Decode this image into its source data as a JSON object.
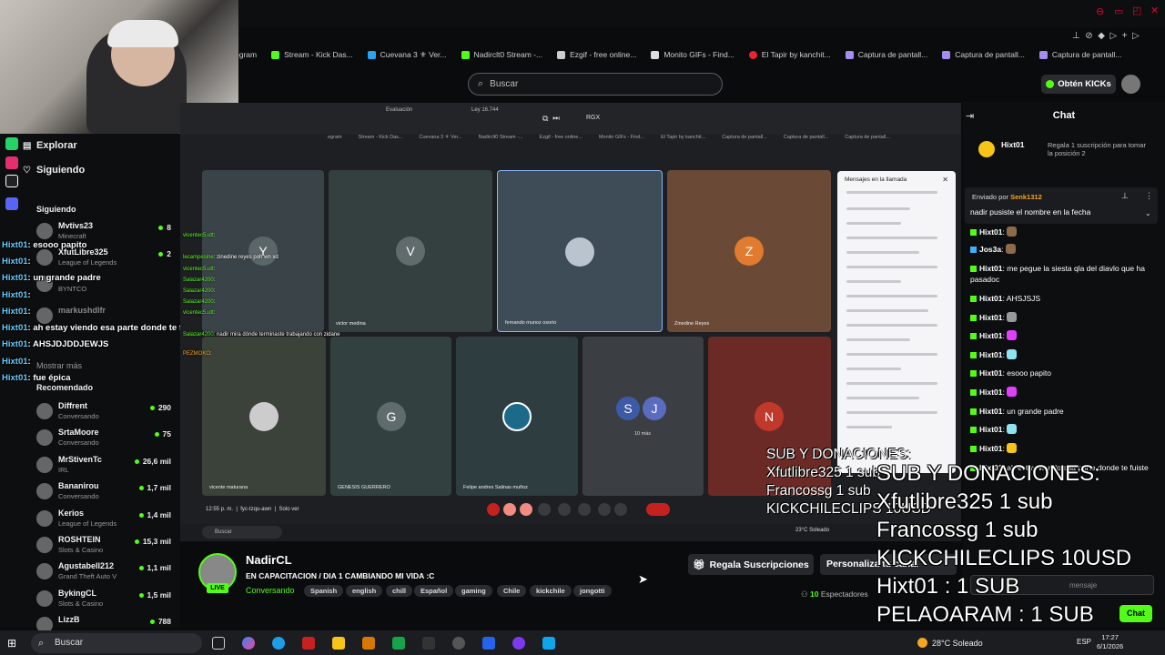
{
  "browser": {
    "bookmarks": [
      "egram",
      "Stream - Kick Das...",
      "Cuevana 3 ⚜ Ver...",
      "Nadirclt0 Stream -...",
      "Ezgif - free online...",
      "Monito GIFs - Find...",
      "El Tapir by kanchit...",
      "Captura de pantall...",
      "Captura de pantall...",
      "Captura de pantall..."
    ],
    "search_placeholder": "Buscar",
    "kicks_button": "Obtén KICKs"
  },
  "sidebar": {
    "explore": "Explorar",
    "following": "Siguiendo",
    "following_title": "Siguiendo",
    "show_more": "Mostrar más",
    "recommended_title": "Recomendado",
    "following_channels": [
      {
        "name": "Mvtivs23",
        "category": "Minecraft",
        "viewers": "8"
      },
      {
        "name": "XfutLibre325",
        "category": "League of Legends",
        "viewers": "2"
      },
      {
        "name": "",
        "category": "BYNTCO",
        "viewers": ""
      },
      {
        "name": "markushdlfr",
        "category": "",
        "viewers": ""
      }
    ],
    "recommended_channels": [
      {
        "name": "Diffrent",
        "category": "Conversando",
        "viewers": "290"
      },
      {
        "name": "SrtaMoore",
        "category": "Conversando",
        "viewers": "75"
      },
      {
        "name": "MrStivenTc",
        "category": "IRL",
        "viewers": "26,6 mil"
      },
      {
        "name": "Bananirou",
        "category": "Conversando",
        "viewers": "1,7 mil"
      },
      {
        "name": "Kerios",
        "category": "League of Legends",
        "viewers": "1,4 mil"
      },
      {
        "name": "ROSHTEIN",
        "category": "Slots & Casino",
        "viewers": "15,3 mil"
      },
      {
        "name": "Agustabell212",
        "category": "Grand Theft Auto V",
        "viewers": "1,1 mil"
      },
      {
        "name": "BykingCL",
        "category": "Slots & Casino",
        "viewers": "1,5 mil"
      },
      {
        "name": "LizzB",
        "category": "ARC Raiders",
        "viewers": "788"
      }
    ]
  },
  "stream_chat_overlay": [
    {
      "user": "Hixt01",
      "text": "esooo papito"
    },
    {
      "user": "Hixt01",
      "text": ""
    },
    {
      "user": "Hixt01",
      "text": "un grande padre"
    },
    {
      "user": "Hixt01",
      "text": ""
    },
    {
      "user": "Hixt01",
      "text": ""
    },
    {
      "user": "Hixt01",
      "text": "ah estay viendo esa parte donde te fuiste"
    },
    {
      "user": "Hixt01",
      "text": "AHSJDJDDJEWJS"
    },
    {
      "user": "Hixt01",
      "text": ""
    },
    {
      "user": "Hixt01",
      "text": "fue épica"
    }
  ],
  "meeting": {
    "tab_label": "Evaluación",
    "tab_label2": "Ley 16.744",
    "bookmarks": [
      "egram",
      "Stream - Kick Das...",
      "Cuevana 3 ⚜ Ver...",
      "Nadirclt0 Stream -...",
      "Ezgif - free online...",
      "Monito GIFs - Find...",
      "El Tapir by kanchit...",
      "Captura de pantall...",
      "Captura de pantall...",
      "Captura de pantall..."
    ],
    "participants": [
      {
        "initial": "Y",
        "name": ""
      },
      {
        "initial": "V",
        "name": "victor medina"
      },
      {
        "initial": "",
        "name": "fernando munoz osorio"
      },
      {
        "initial": "Z",
        "name": "Zinedine Reyes"
      },
      {
        "initial": "",
        "name": "vicente maturana"
      },
      {
        "initial": "G",
        "name": "GENESIS GUERRERO"
      },
      {
        "initial": "",
        "name": "Felipe andres Salinas muñoz"
      },
      {
        "initial": "S",
        "name": "10 más"
      },
      {
        "initial": "N",
        "name": ""
      }
    ],
    "messages_title": "Mensajes en la llamada",
    "time": "12:55 p. m.",
    "code": "fyc-tzqu-awn",
    "mode": "Solo ver",
    "inner_search": "Buscar",
    "inner_weather": "23°C Soleado",
    "overlay_chat": [
      {
        "user": "vicentec5.utt",
        "text": ""
      },
      {
        "user": "lecampesine",
        "text": "zinedine reyes poh wn xd"
      },
      {
        "user": "vicentec5.utt",
        "text": ""
      },
      {
        "user": "Salazar4200",
        "text": ""
      },
      {
        "user": "Salazar4200",
        "text": ""
      },
      {
        "user": "Salazar4200",
        "text": ""
      },
      {
        "user": "vicentec5.utt",
        "text": ""
      },
      {
        "user": "Salazar4200",
        "text": "nadir mira dónde terminaste trabajando con zidane"
      },
      {
        "user": "PEZMOKO",
        "text": ""
      }
    ]
  },
  "stream": {
    "streamer": "NadirCL",
    "live": "LIVE",
    "title": "EN CAPACITACION / DIA 1 CAMBIANDO MI VIDA :C",
    "category": "Conversando",
    "tags": [
      "Spanish",
      "english",
      "chill",
      "Español",
      "gaming",
      "Chile",
      "kickchile",
      "jongotti"
    ],
    "gift_subs": "Regala Suscripciones",
    "customize": "Personaliza tu canal",
    "viewers": "10",
    "viewers_label": "Espectadores"
  },
  "chat": {
    "title": "Chat",
    "gift_user": "Hixt01",
    "gift_text": "Regala 1 suscripción para tomar la posición 2",
    "pinned_by_label": "Enviado por",
    "pinned_by": "Senk1312",
    "pinned_text": "nadir pusiste el nombre en la fecha",
    "messages": [
      {
        "user": "Hixt01",
        "text": ""
      },
      {
        "user": "Jos3a",
        "text": ""
      },
      {
        "user": "Hixt01",
        "text": "me pegue la siesta qla del diavlo que ha pasadoc"
      },
      {
        "user": "Hixt01",
        "text": "AHSJSJS"
      },
      {
        "user": "Hixt01",
        "text": ""
      },
      {
        "user": "Hixt01",
        "text": ""
      },
      {
        "user": "Hixt01",
        "text": ""
      },
      {
        "user": "Hixt01",
        "text": "esooo papito"
      },
      {
        "user": "Hixt01",
        "text": ""
      },
      {
        "user": "Hixt01",
        "text": "un grande padre"
      },
      {
        "user": "Hixt01",
        "text": ""
      },
      {
        "user": "Hixt01",
        "text": ""
      },
      {
        "user": "Hixt01",
        "text": "ah estay viendo esa parte donde te fuiste"
      }
    ],
    "input_placeholder": "mensaje",
    "send": "Chat"
  },
  "overlays": {
    "donations_small": [
      "SUB Y DONACIONES:",
      "Xfutlibre325 1 sub",
      "Francossg 1 sub",
      "KICKCHILECLIPS 10USD"
    ],
    "donations_big": [
      "SUB Y DONACIONES:",
      "Xfutlibre325 1 sub",
      "Francossg 1 sub",
      "KICKCHILECLIPS 10USD",
      "Hixt01 : 1 SUB",
      "PELAOARAM : 1 SUB"
    ]
  },
  "taskbar": {
    "search": "Buscar",
    "weather": "28°C Soleado",
    "lang": "ESP",
    "time": "17:27",
    "date": "6/1/2026"
  },
  "colors": {
    "kick_green": "#53fc18",
    "background": "#0a0b0d"
  }
}
